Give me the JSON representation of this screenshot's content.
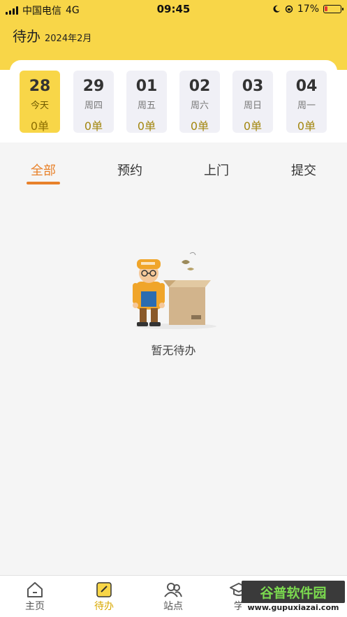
{
  "status_bar": {
    "carrier": "中国电信",
    "network": "4G",
    "time": "09:45",
    "battery": "17%",
    "battery_level": 0.17
  },
  "header": {
    "title": "待办",
    "month": "2024年2月"
  },
  "days": [
    {
      "num": "28",
      "weekday": "今天",
      "count": "0单",
      "active": true
    },
    {
      "num": "29",
      "weekday": "周四",
      "count": "0单",
      "active": false
    },
    {
      "num": "01",
      "weekday": "周五",
      "count": "0单",
      "active": false
    },
    {
      "num": "02",
      "weekday": "周六",
      "count": "0单",
      "active": false
    },
    {
      "num": "03",
      "weekday": "周日",
      "count": "0单",
      "active": false
    },
    {
      "num": "04",
      "weekday": "周一",
      "count": "0单",
      "active": false
    }
  ],
  "filter_tabs": [
    {
      "label": "全部",
      "active": true
    },
    {
      "label": "预约",
      "active": false
    },
    {
      "label": "上门",
      "active": false
    },
    {
      "label": "提交",
      "active": false
    }
  ],
  "empty_state": {
    "message": "暂无待办"
  },
  "tabbar": [
    {
      "label": "主页",
      "icon": "home-icon",
      "active": false
    },
    {
      "label": "待办",
      "icon": "todo-icon",
      "active": true
    },
    {
      "label": "站点",
      "icon": "station-icon",
      "active": false
    },
    {
      "label": "学",
      "icon": "study-icon",
      "active": false
    }
  ],
  "watermark": {
    "text": "谷普软件园",
    "url": "www.gupuxiazai.com"
  },
  "colors": {
    "brand_yellow": "#f8d648",
    "accent_orange": "#e8812a",
    "count_gold": "#a38710"
  }
}
